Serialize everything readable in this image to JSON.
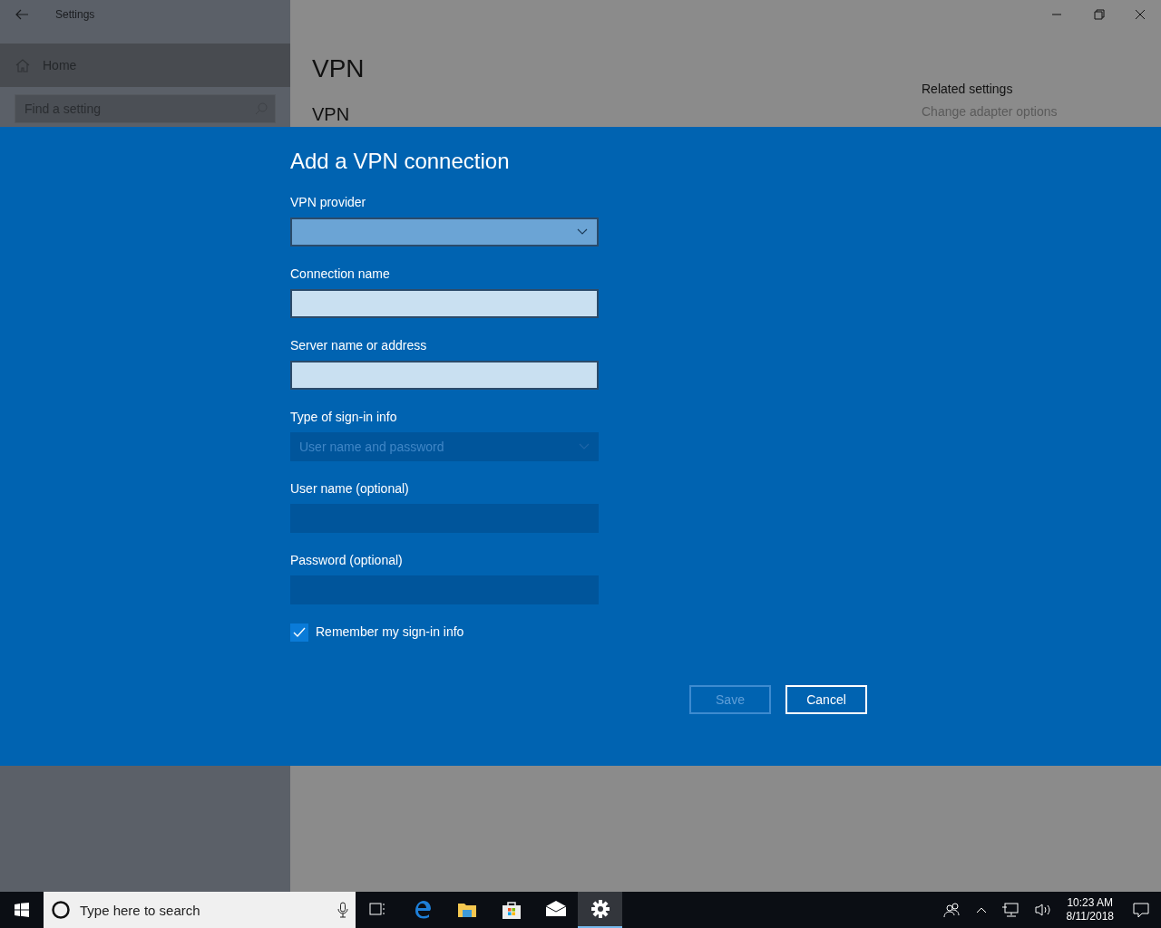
{
  "window": {
    "title": "Settings"
  },
  "sidebar": {
    "home": "Home",
    "search": {
      "placeholder": "Find a setting"
    }
  },
  "main": {
    "title": "VPN",
    "section": "VPN",
    "related": {
      "heading": "Related settings",
      "links": [
        "Change adapter options"
      ]
    }
  },
  "dialog": {
    "title": "Add a VPN connection",
    "fields": [
      {
        "label": "VPN provider",
        "kind": "dropdown",
        "disabled": false
      },
      {
        "label": "Connection name",
        "kind": "text",
        "disabled": false
      },
      {
        "label": "Server name or address",
        "kind": "text",
        "disabled": false
      },
      {
        "label": "Type of sign-in info",
        "kind": "dropdown",
        "disabled": true,
        "value": "User name and password"
      },
      {
        "label": "User name (optional)",
        "kind": "text",
        "disabled": true
      },
      {
        "label": "Password (optional)",
        "kind": "password",
        "disabled": true
      }
    ],
    "remember": {
      "label": "Remember my sign-in info",
      "checked": true
    },
    "buttons": [
      {
        "label": "Save",
        "disabled": true
      },
      {
        "label": "Cancel",
        "disabled": false
      }
    ]
  },
  "taskbar": {
    "search": {
      "placeholder": "Type here to search"
    },
    "apps": [
      {
        "kind": "taskview",
        "active": false
      },
      {
        "kind": "edge",
        "active": false
      },
      {
        "kind": "explorer",
        "active": false
      },
      {
        "kind": "store",
        "active": false
      },
      {
        "kind": "mail",
        "active": false
      },
      {
        "kind": "settings",
        "active": true
      }
    ],
    "clock": {
      "time": "10:23 AM",
      "date": "8/11/2018"
    }
  }
}
